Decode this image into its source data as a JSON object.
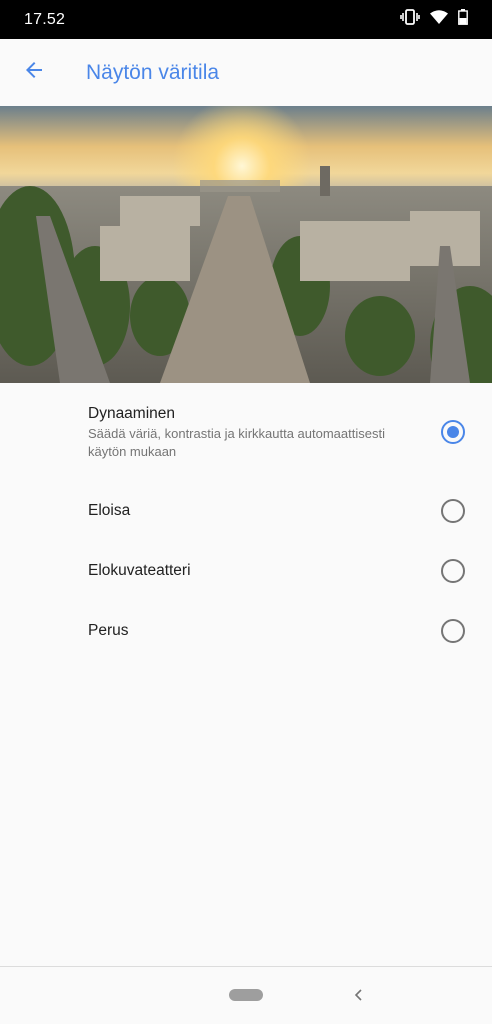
{
  "status_bar": {
    "time": "17.52",
    "icons": [
      "vibrate-icon",
      "wifi-icon",
      "battery-icon"
    ]
  },
  "app_bar": {
    "title": "Näytön väritila",
    "back_icon": "arrow-back-icon",
    "accent": "#4a86e8"
  },
  "hero": {
    "description_icon": "city-sunset-image"
  },
  "options": [
    {
      "title": "Dynaaminen",
      "summary": "Säädä väriä, kontrastia ja kirkkautta automaattisesti käytön mukaan",
      "selected": true
    },
    {
      "title": "Eloisa",
      "selected": false
    },
    {
      "title": "Elokuvateatteri",
      "selected": false
    },
    {
      "title": "Perus",
      "selected": false
    }
  ],
  "nav_bar": {
    "home": "home-pill",
    "back": "nav-back-icon"
  }
}
